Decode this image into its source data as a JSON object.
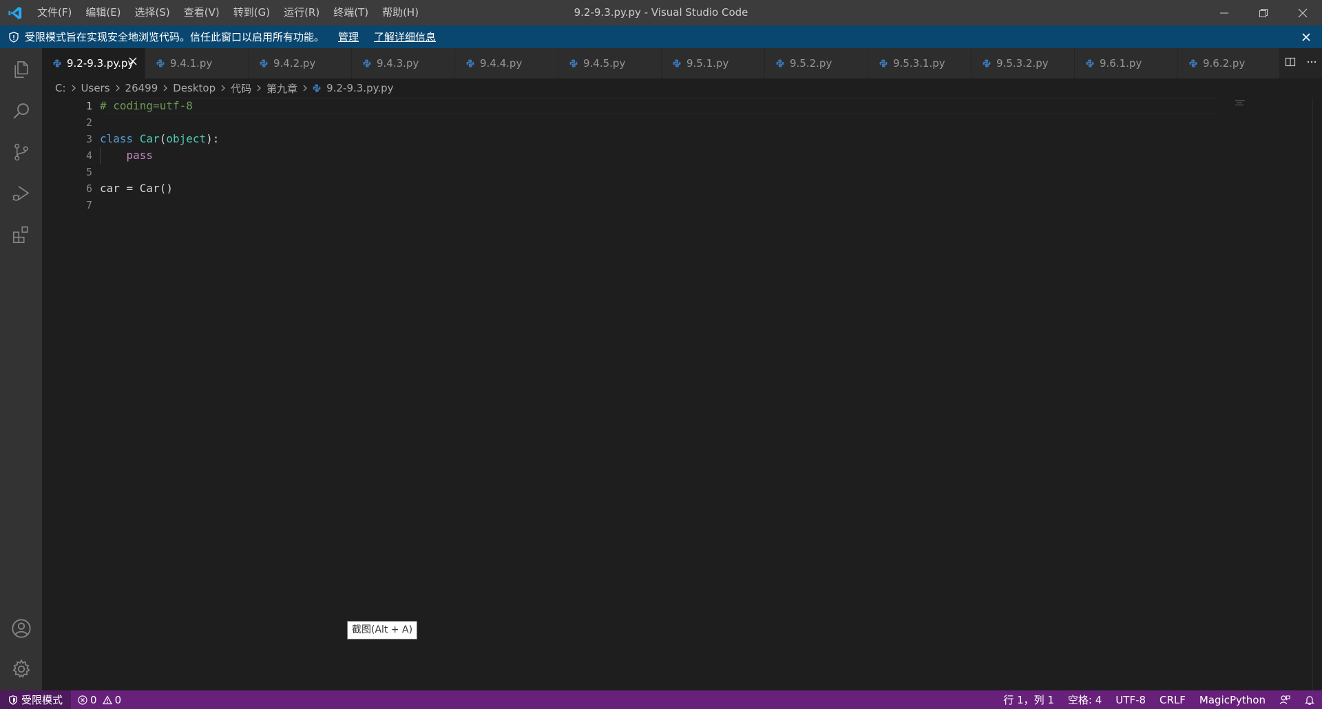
{
  "app": {
    "window_title": "9.2-9.3.py.py - Visual Studio Code",
    "menu": [
      "文件(F)",
      "编辑(E)",
      "选择(S)",
      "查看(V)",
      "转到(G)",
      "运行(R)",
      "终端(T)",
      "帮助(H)"
    ]
  },
  "banner": {
    "message": "受限模式旨在实现安全地浏览代码。信任此窗口以启用所有功能。",
    "manage_link": "管理",
    "learn_more_link": "了解详细信息"
  },
  "tabs": [
    {
      "label": "9.2-9.3.py.py",
      "active": true
    },
    {
      "label": "9.4.1.py",
      "active": false
    },
    {
      "label": "9.4.2.py",
      "active": false
    },
    {
      "label": "9.4.3.py",
      "active": false
    },
    {
      "label": "9.4.4.py",
      "active": false
    },
    {
      "label": "9.4.5.py",
      "active": false
    },
    {
      "label": "9.5.1.py",
      "active": false
    },
    {
      "label": "9.5.2.py",
      "active": false
    },
    {
      "label": "9.5.3.1.py",
      "active": false
    },
    {
      "label": "9.5.3.2.py",
      "active": false
    },
    {
      "label": "9.6.1.py",
      "active": false
    },
    {
      "label": "9.6.2.py",
      "active": false
    }
  ],
  "breadcrumb": {
    "items": [
      "C:",
      "Users",
      "26499",
      "Desktop",
      "代码",
      "第九章"
    ],
    "file": "9.2-9.3.py.py"
  },
  "editor": {
    "line_numbers": [
      "1",
      "2",
      "3",
      "4",
      "5",
      "6",
      "7"
    ],
    "current_line": 1,
    "lines": {
      "l1_comment": "# coding=utf-8",
      "l3_kw": "class",
      "l3_name": "Car",
      "l3_paren_open": "(",
      "l3_base": "object",
      "l3_end": "):",
      "l4_indent": "    ",
      "l4_kw": "pass",
      "l6_code_a": "car = ",
      "l6_class": "Car",
      "l6_code_b": "()"
    }
  },
  "tooltip": {
    "text": "截图(Alt + A)"
  },
  "statusbar": {
    "mode": "受限模式",
    "errors": "0",
    "warnings": "0",
    "position": "行 1，列 1",
    "spaces": "空格: 4",
    "encoding": "UTF-8",
    "eol": "CRLF",
    "language": "MagicPython"
  },
  "colors": {
    "titlebar": "#3c3c3c",
    "banner": "#094771",
    "activitybar": "#333333",
    "editor_bg": "#1e1e1e",
    "statusbar": "#68217a",
    "accent": "#007acc"
  }
}
